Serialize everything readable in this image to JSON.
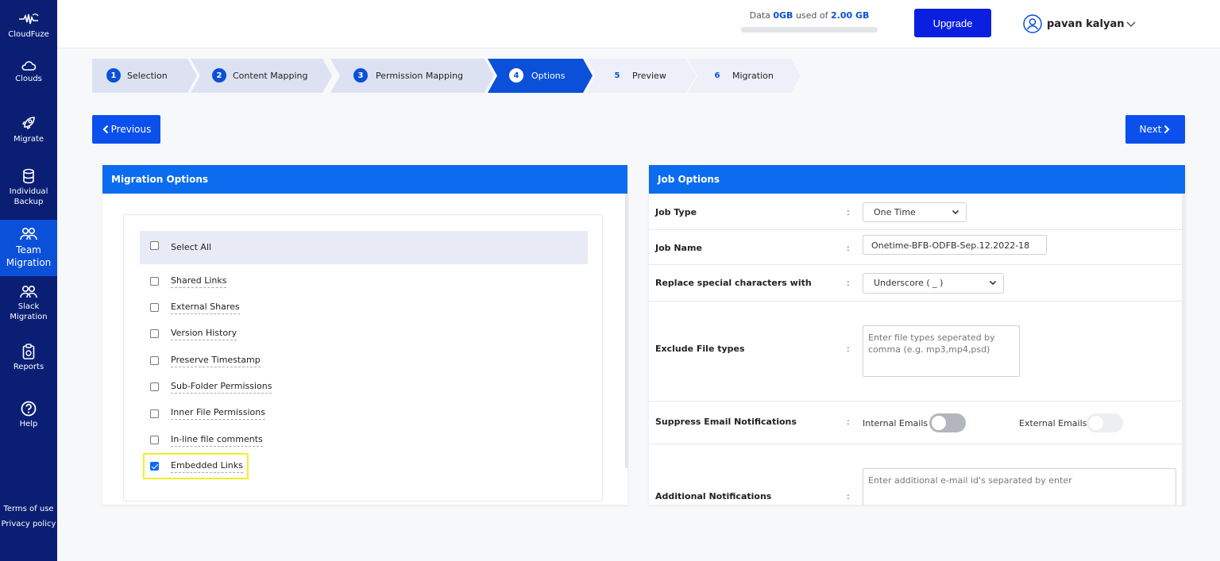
{
  "sidebar": {
    "brand": "CloudFuze",
    "items": [
      {
        "label": "Clouds",
        "icon": "cloud-icon"
      },
      {
        "label": "Migrate",
        "icon": "rocket-icon"
      },
      {
        "label": "Individual Backup",
        "icon": "database-icon"
      },
      {
        "label": "Team Migration",
        "icon": "team-icon",
        "active": true
      },
      {
        "label": "Slack Migration",
        "icon": "team-icon"
      },
      {
        "label": "Reports",
        "icon": "clipboard-icon"
      },
      {
        "label": "Help",
        "icon": "help-icon"
      }
    ],
    "footer": {
      "terms": "Terms of use",
      "privacy": "Privacy policy"
    }
  },
  "header": {
    "usage_prefix": "Data ",
    "usage_used": "0GB",
    "usage_mid": " used of ",
    "usage_total": "2.00 GB",
    "usage_fraction": 0,
    "upgrade_label": "Upgrade",
    "user_name": "pavan kalyan"
  },
  "steps": [
    {
      "num": "1",
      "label": "Selection",
      "state": "done"
    },
    {
      "num": "2",
      "label": "Content Mapping",
      "state": "done"
    },
    {
      "num": "3",
      "label": "Permission Mapping",
      "state": "done"
    },
    {
      "num": "4",
      "label": "Options",
      "state": "active"
    },
    {
      "num": "5",
      "label": "Preview",
      "state": "future"
    },
    {
      "num": "6",
      "label": "Migration",
      "state": "future"
    }
  ],
  "nav": {
    "previous": "Previous",
    "next": "Next"
  },
  "migration_options": {
    "title": "Migration Options",
    "select_all": "Select All",
    "options": [
      {
        "label": "Shared Links",
        "checked": false
      },
      {
        "label": "External Shares",
        "checked": false
      },
      {
        "label": "Version History",
        "checked": false
      },
      {
        "label": "Preserve Timestamp",
        "checked": false
      },
      {
        "label": "Sub-Folder Permissions",
        "checked": false
      },
      {
        "label": "Inner File Permissions",
        "checked": false
      },
      {
        "label": "In-line file comments",
        "checked": false
      },
      {
        "label": "Embedded Links",
        "checked": true
      }
    ]
  },
  "job_options": {
    "title": "Job Options",
    "job_type": {
      "label": "Job Type",
      "value": "One Time"
    },
    "job_name": {
      "label": "Job Name",
      "value": "Onetime-BFB-ODFB-Sep.12.2022-18"
    },
    "replace_chars": {
      "label": "Replace special characters with",
      "value": "Underscore ( _ )"
    },
    "exclude": {
      "label": "Exclude File types",
      "placeholder": "Enter file types seperated by comma (e.g. mp3,mp4,psd)"
    },
    "suppress": {
      "label": "Suppress Email Notifications",
      "internal": "Internal Emails",
      "external": "External Emails"
    },
    "additional": {
      "label": "Additional Notifications",
      "placeholder": "Enter additional e-mail id's separated by enter"
    },
    "colon": ":"
  },
  "colors": {
    "sidebar": "#0a1f74",
    "accent": "#0b50d9",
    "panel_head": "#0b6cf0",
    "upgrade": "#0b1fe0",
    "highlight": "#f3ef26"
  }
}
